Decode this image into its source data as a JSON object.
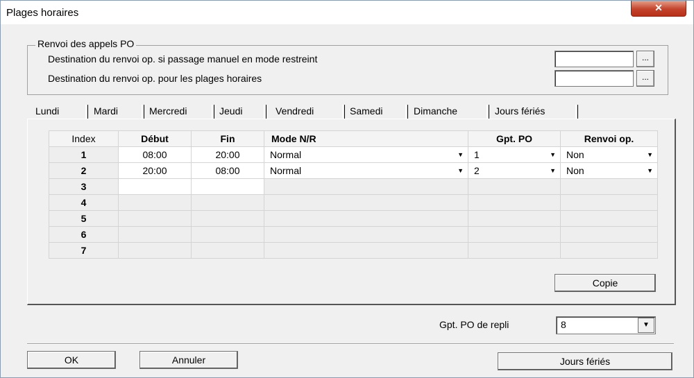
{
  "window": {
    "title": "Plages horaires",
    "close_glyph": "✕"
  },
  "group": {
    "legend": "Renvoi des appels PO",
    "row1_label": "Destination du renvoi op. si passage manuel en mode restreint",
    "row2_label": "Destination du renvoi op. pour les plages horaires",
    "row1_value": "",
    "row2_value": "",
    "browse_label": "..."
  },
  "tabs": [
    "Lundi",
    "Mardi",
    "Mercredi",
    "Jeudi",
    "Vendredi",
    "Samedi",
    "Dimanche",
    "Jours fériés"
  ],
  "active_tab": "Lundi",
  "table": {
    "headers": [
      "Index",
      "Début",
      "Fin",
      "Mode N/R",
      "Gpt. PO",
      "Renvoi op."
    ],
    "rows": [
      {
        "index": "1",
        "debut": "08:00",
        "fin": "20:00",
        "mode": "Normal",
        "gpt": "1",
        "renvoi": "Non"
      },
      {
        "index": "2",
        "debut": "20:00",
        "fin": "08:00",
        "mode": "Normal",
        "gpt": "2",
        "renvoi": "Non"
      },
      {
        "index": "3",
        "debut": "",
        "fin": "",
        "mode": "",
        "gpt": "",
        "renvoi": ""
      },
      {
        "index": "4",
        "debut": "",
        "fin": "",
        "mode": "",
        "gpt": "",
        "renvoi": ""
      },
      {
        "index": "5",
        "debut": "",
        "fin": "",
        "mode": "",
        "gpt": "",
        "renvoi": ""
      },
      {
        "index": "6",
        "debut": "",
        "fin": "",
        "mode": "",
        "gpt": "",
        "renvoi": ""
      },
      {
        "index": "7",
        "debut": "",
        "fin": "",
        "mode": "",
        "gpt": "",
        "renvoi": ""
      }
    ],
    "dropdown_glyph": "▼"
  },
  "copie_button": "Copie",
  "repli": {
    "label": "Gpt. PO de repli",
    "value": "8"
  },
  "footer": {
    "ok": "OK",
    "annuler": "Annuler",
    "jours_feries": "Jours fériés"
  }
}
